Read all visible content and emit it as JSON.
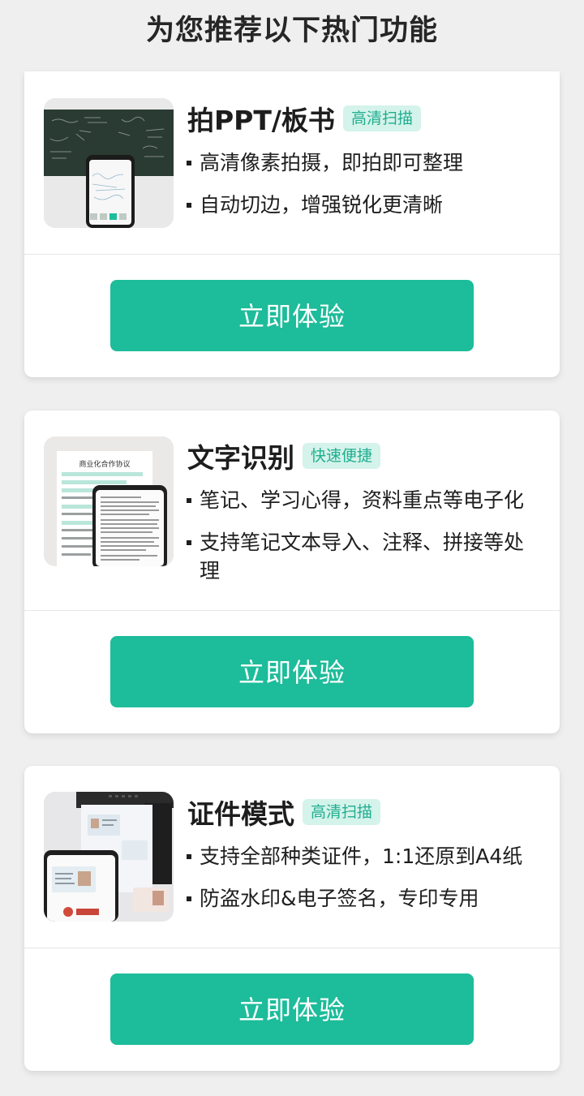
{
  "page": {
    "title": "为您推荐以下热门功能"
  },
  "theme": {
    "accent": "#1dbc9a",
    "tag_text": "#1fae90",
    "tag_bg": "#d4f3ea",
    "background": "#efefef"
  },
  "features": [
    {
      "icon": "blackboard-scan-thumbnail",
      "title": "拍PPT/板书",
      "tag": "高清扫描",
      "bullets": [
        "高清像素拍摄，即拍即可整理",
        "自动切边，增强锐化更清晰"
      ],
      "button_label": "立即体验"
    },
    {
      "icon": "text-recognition-thumbnail",
      "title": "文字识别",
      "tag": "快速便捷",
      "bullets": [
        "笔记、学习心得，资料重点等电子化",
        "支持笔记文本导入、注释、拼接等处理"
      ],
      "button_label": "立即体验",
      "thumbnail_text": "商业化合作协议"
    },
    {
      "icon": "id-card-scan-thumbnail",
      "title": "证件模式",
      "tag": "高清扫描",
      "bullets": [
        "支持全部种类证件，1:1还原到A4纸",
        "防盗水印&电子签名，专印专用"
      ],
      "button_label": "立即体验"
    }
  ]
}
